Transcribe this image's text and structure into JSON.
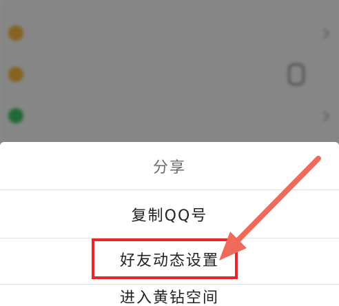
{
  "background_list": {
    "rows": [
      {
        "label": "",
        "icon_color": "#f3b63c"
      },
      {
        "label": "",
        "icon_color": "#f3b63c",
        "has_extra_icon": true
      },
      {
        "label": "",
        "icon_color": "#3cc46a"
      }
    ]
  },
  "action_sheet": {
    "items": [
      {
        "label": "分享"
      },
      {
        "label": "复制QQ号"
      },
      {
        "label": "好友动态设置"
      },
      {
        "label": "进入黄钻空间"
      }
    ]
  },
  "annotation": {
    "highlight_color": "#e8262a",
    "arrow_color": "#f06a5c"
  }
}
